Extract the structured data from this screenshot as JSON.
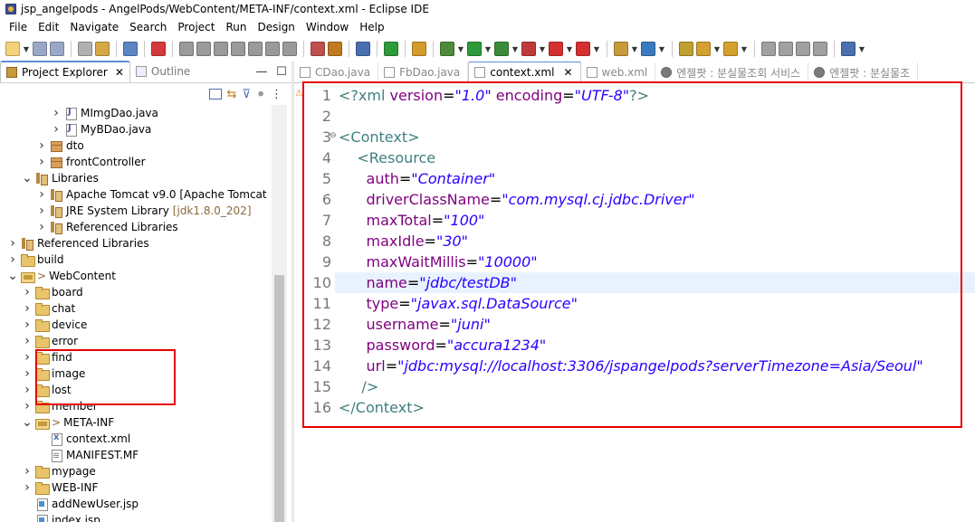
{
  "window": {
    "title": "jsp_angelpods - AngelPods/WebContent/META-INF/context.xml - Eclipse IDE"
  },
  "menu": [
    "File",
    "Edit",
    "Navigate",
    "Search",
    "Project",
    "Run",
    "Design",
    "Window",
    "Help"
  ],
  "left_panel": {
    "tabs": [
      {
        "label": "Project Explorer",
        "active": true
      },
      {
        "label": "Outline",
        "active": false
      }
    ],
    "tree": [
      {
        "label": "MImgDao.java",
        "icon": "java-file-icon",
        "indent": 5,
        "twisty": ">"
      },
      {
        "label": "MyBDao.java",
        "icon": "java-file-icon",
        "indent": 5,
        "twisty": ">"
      },
      {
        "label": "dto",
        "icon": "package-icon",
        "indent": 4,
        "twisty": ">"
      },
      {
        "label": "frontController",
        "icon": "package-icon",
        "indent": 4,
        "twisty": ">"
      },
      {
        "label": "Libraries",
        "icon": "library-icon",
        "indent": 3,
        "twisty": "v"
      },
      {
        "label": "Apache Tomcat v9.0 [Apache Tomcat",
        "icon": "library-icon",
        "indent": 4,
        "twisty": ">"
      },
      {
        "label": "JRE System Library",
        "suffix": "[jdk1.8.0_202]",
        "icon": "library-icon",
        "indent": 4,
        "twisty": ">"
      },
      {
        "label": "Referenced Libraries",
        "icon": "library-icon",
        "indent": 4,
        "twisty": ">"
      },
      {
        "label": "Referenced Libraries",
        "icon": "library-icon",
        "indent": 2,
        "twisty": ">"
      },
      {
        "label": "build",
        "icon": "folder-icon",
        "indent": 2,
        "twisty": ">"
      },
      {
        "label": "WebContent",
        "prefix": ">",
        "icon": "folder-open-icon",
        "indent": 2,
        "twisty": "v"
      },
      {
        "label": "board",
        "icon": "folder-icon",
        "indent": 3,
        "twisty": ">"
      },
      {
        "label": "chat",
        "icon": "folder-icon",
        "indent": 3,
        "twisty": ">"
      },
      {
        "label": "device",
        "icon": "folder-icon",
        "indent": 3,
        "twisty": ">"
      },
      {
        "label": "error",
        "icon": "folder-icon",
        "indent": 3,
        "twisty": ">"
      },
      {
        "label": "find",
        "icon": "folder-icon",
        "indent": 3,
        "twisty": ">"
      },
      {
        "label": "image",
        "icon": "folder-icon",
        "indent": 3,
        "twisty": ">"
      },
      {
        "label": "lost",
        "icon": "folder-icon",
        "indent": 3,
        "twisty": ">"
      },
      {
        "label": "member",
        "icon": "folder-icon",
        "indent": 3,
        "twisty": ">"
      },
      {
        "label": "META-INF",
        "prefix": ">",
        "icon": "folder-open-icon",
        "indent": 3,
        "twisty": "v"
      },
      {
        "label": "context.xml",
        "icon": "xml-file-icon",
        "indent": 4,
        "twisty": ""
      },
      {
        "label": "MANIFEST.MF",
        "icon": "text-file-icon",
        "indent": 4,
        "twisty": ""
      },
      {
        "label": "mypage",
        "icon": "folder-icon",
        "indent": 3,
        "twisty": ">"
      },
      {
        "label": "WEB-INF",
        "icon": "folder-icon",
        "indent": 3,
        "twisty": ">"
      },
      {
        "label": "addNewUser.jsp",
        "icon": "jsp-file-icon",
        "indent": 3,
        "twisty": ""
      },
      {
        "label": "index.jsp",
        "icon": "jsp-file-icon",
        "indent": 3,
        "twisty": ""
      }
    ]
  },
  "editor": {
    "tabs": [
      {
        "label": "CDao.java",
        "icon": "java-file-icon",
        "active": false
      },
      {
        "label": "FbDao.java",
        "icon": "java-file-icon",
        "active": false
      },
      {
        "label": "context.xml",
        "icon": "xml-file-icon",
        "active": true
      },
      {
        "label": "web.xml",
        "icon": "xml-file-icon",
        "active": false
      },
      {
        "label": "엔젤팟 : 분실물조회 서비스",
        "icon": "web-icon",
        "active": false
      },
      {
        "label": "엔젤팟 : 분실물조",
        "icon": "web-icon",
        "active": false
      }
    ],
    "highlighted_line": 10,
    "lines": [
      {
        "n": "1",
        "tokens": [
          [
            "pi",
            "<?"
          ],
          [
            "tag",
            "xml "
          ],
          [
            "attr",
            "version"
          ],
          [
            "eq",
            "="
          ],
          [
            "val",
            "\"1.0\""
          ],
          [
            "tag",
            " "
          ],
          [
            "attr",
            "encoding"
          ],
          [
            "eq",
            "="
          ],
          [
            "val",
            "\"UTF-8\""
          ],
          [
            "pi",
            "?>"
          ]
        ]
      },
      {
        "n": "2",
        "tokens": []
      },
      {
        "n": "3",
        "tokens": [
          [
            "tag",
            "<Context>"
          ]
        ]
      },
      {
        "n": "4",
        "tokens": [
          [
            "tag",
            "    <Resource"
          ]
        ]
      },
      {
        "n": "5",
        "tokens": [
          [
            "attr",
            "      auth"
          ],
          [
            "eq",
            "="
          ],
          [
            "val",
            "\"Container\""
          ]
        ]
      },
      {
        "n": "6",
        "tokens": [
          [
            "attr",
            "      driverClassName"
          ],
          [
            "eq",
            "="
          ],
          [
            "val",
            "\"com.mysql.cj.jdbc.Driver\""
          ]
        ]
      },
      {
        "n": "7",
        "tokens": [
          [
            "attr",
            "      maxTotal"
          ],
          [
            "eq",
            "="
          ],
          [
            "val",
            "\"100\""
          ]
        ]
      },
      {
        "n": "8",
        "tokens": [
          [
            "attr",
            "      maxIdle"
          ],
          [
            "eq",
            "="
          ],
          [
            "val",
            "\"30\""
          ]
        ]
      },
      {
        "n": "9",
        "tokens": [
          [
            "attr",
            "      maxWaitMillis"
          ],
          [
            "eq",
            "="
          ],
          [
            "val",
            "\"10000\""
          ]
        ]
      },
      {
        "n": "10",
        "tokens": [
          [
            "attr",
            "      name"
          ],
          [
            "eq",
            "="
          ],
          [
            "val",
            "\"jdbc/testDB\""
          ]
        ]
      },
      {
        "n": "11",
        "tokens": [
          [
            "attr",
            "      type"
          ],
          [
            "eq",
            "="
          ],
          [
            "val",
            "\"javax.sql.DataSource\""
          ]
        ]
      },
      {
        "n": "12",
        "tokens": [
          [
            "attr",
            "      username"
          ],
          [
            "eq",
            "="
          ],
          [
            "val",
            "\"juni\""
          ]
        ]
      },
      {
        "n": "13",
        "tokens": [
          [
            "attr",
            "      password"
          ],
          [
            "eq",
            "="
          ],
          [
            "val",
            "\"accura1234\""
          ]
        ]
      },
      {
        "n": "14",
        "tokens": [
          [
            "attr",
            "      url"
          ],
          [
            "eq",
            "="
          ],
          [
            "val",
            "\"jdbc:mysql://localhost:3306/jspangelpods?serverTimezone=Asia/Seoul\""
          ]
        ]
      },
      {
        "n": "15",
        "tokens": [
          [
            "tag",
            "     />"
          ]
        ]
      },
      {
        "n": "16",
        "tokens": [
          [
            "tag",
            "</Context>"
          ]
        ]
      }
    ]
  },
  "colors": {
    "tag": "#3f7f7f",
    "attribute": "#7f007f",
    "value": "#2a00ff",
    "annotation_box": "#e60000",
    "active_tab_accent": "#5a8fd6"
  }
}
